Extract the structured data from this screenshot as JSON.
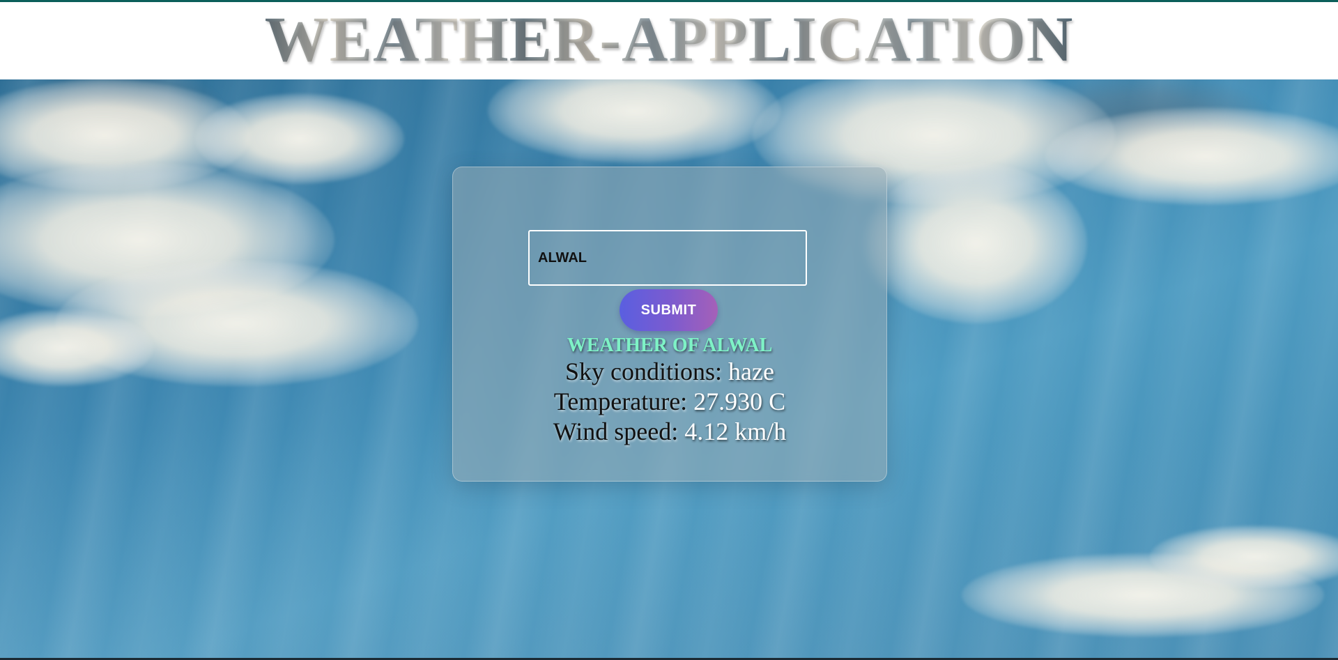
{
  "app": {
    "title": "WEATHER-APPLICATION"
  },
  "search": {
    "value": "ALWAL",
    "placeholder": ""
  },
  "form": {
    "submit_label": "SUBMIT"
  },
  "result": {
    "heading": "WEATHER OF ALWAL",
    "sky_label": "Sky conditions:",
    "sky_value": "haze",
    "temp_label": "Temperature:",
    "temp_value": "27.930 C",
    "wind_label": "Wind speed:",
    "wind_value": "4.12 km/h"
  },
  "colors": {
    "accent_top": "#0b5f5a",
    "heading_text": "#7ef2c6",
    "button_gradient_start": "#5a5fe0",
    "button_gradient_end": "#a560b8"
  }
}
